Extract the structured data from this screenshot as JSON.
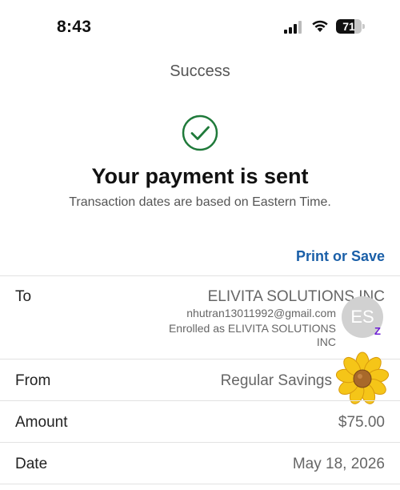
{
  "status_bar": {
    "time": "8:43",
    "battery_level": "71",
    "battery_fraction": 0.71
  },
  "nav": {
    "title": "Success"
  },
  "confirmation": {
    "headline": "Your payment is sent",
    "note": "Transaction dates are based on Eastern Time.",
    "print_label": "Print or Save"
  },
  "details": {
    "to": {
      "label": "To",
      "name": "ELIVITA SOLUTIONS INC",
      "email": "nhutran13011992@gmail.com",
      "enrolled_line1": "Enrolled as ELIVITA SOLUTIONS",
      "enrolled_line2": "INC",
      "avatar_initials": "ES",
      "badge": "Z"
    },
    "from": {
      "label": "From",
      "value": "Regular Savings"
    },
    "amount": {
      "label": "Amount",
      "value": "$75.00"
    },
    "date": {
      "label": "Date",
      "value": "May 18, 2026"
    }
  },
  "colors": {
    "accent": "#1a5fa8",
    "success": "#1f7a3a",
    "zelle": "#6d1ed4"
  },
  "icons": [
    "signal-icon",
    "wifi-icon",
    "battery-icon",
    "checkmark-circle-icon",
    "zelle-icon",
    "flower-sticker"
  ]
}
